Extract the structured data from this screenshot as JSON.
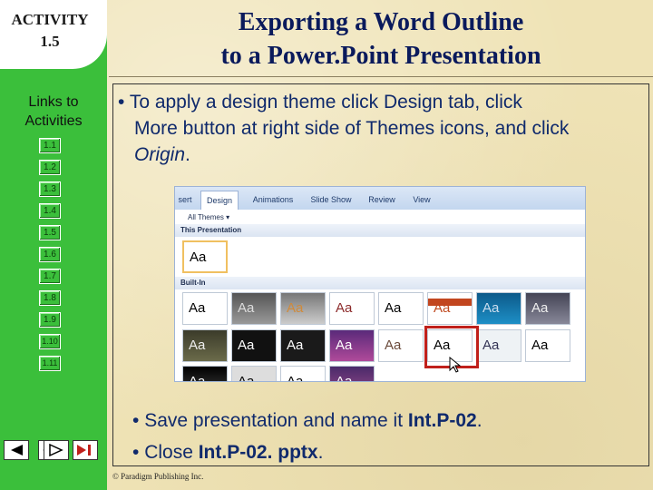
{
  "activity": {
    "line1": "ACTIVITY",
    "line2": "1.5"
  },
  "title": {
    "line1": "Exporting a Word Outline",
    "line2": "to a Power.Point Presentation"
  },
  "sidebar": {
    "links_title_1": "Links to",
    "links_title_2": "Activities",
    "links": [
      "1.1",
      "1.2",
      "1.3",
      "1.4",
      "1.5",
      "1.6",
      "1.7",
      "1.8",
      "1.9",
      "1.10",
      "1.11"
    ]
  },
  "bullets": {
    "b1_part1": "To apply a design theme click Design tab, click",
    "b1_part2": "More button at right side of Themes icons, and click",
    "b1_part3_italic": "Origin",
    "b1_part3_end": ".",
    "b2_prefix": "Save presentation and name it ",
    "b2_bold": "Int.P-02",
    "b2_suffix": ".",
    "b3_prefix": "Close ",
    "b3_bold": "Int.P-02. pptx",
    "b3_suffix": "."
  },
  "screenshot": {
    "tabs": [
      "sert",
      "Design",
      "Animations",
      "Slide Show",
      "Review",
      "View"
    ],
    "active_tab": "Design",
    "dropdown": "All Themes ▾",
    "section_this": "This Presentation",
    "section_builtin": "Built-In",
    "thumb_label": "Aa"
  },
  "footer": "© Paradigm Publishing Inc.",
  "colors": {
    "sidebar": "#3bbf3b",
    "title": "#0a1a5c",
    "text": "#102a6c",
    "highlight": "#c0201b"
  },
  "nav_icons": [
    "prev-icon",
    "back-icon",
    "next-icon",
    "end-icon"
  ]
}
